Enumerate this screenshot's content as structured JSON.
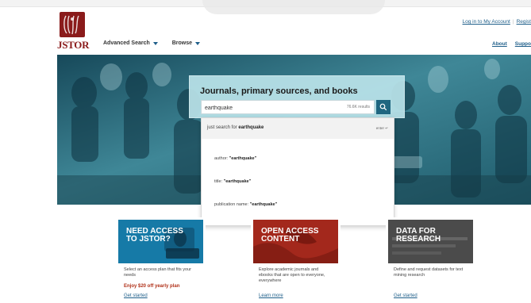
{
  "brand": {
    "logo_text": "JSTOR"
  },
  "header": {
    "login_link": "Log in to My Account",
    "register_link": "Regist",
    "about_link": "About",
    "support_link": "Suppo",
    "nav": [
      {
        "label": "Advanced Search"
      },
      {
        "label": "Browse"
      }
    ]
  },
  "hero": {
    "search": {
      "title": "Journals, primary sources, and books",
      "value": "earthquake",
      "result_count": "76.6K results"
    }
  },
  "dropdown": {
    "primary_prefix": "just search for",
    "primary_term": "earthquake",
    "enter_hint": "enter ↵",
    "suggestions": [
      {
        "field": "author:",
        "value": "\"earthquake\""
      },
      {
        "field": "title:",
        "value": "\"earthquake\""
      },
      {
        "field": "publication name:",
        "value": "\"earthquake\""
      }
    ]
  },
  "cards": [
    {
      "title_line1": "NEED ACCESS",
      "title_line2": "TO JSTOR?",
      "description": "Select an access plan that fits your needs",
      "promo": "Enjoy $20 off yearly plan",
      "link": "Get started"
    },
    {
      "title_line1": "OPEN ACCESS",
      "title_line2": "CONTENT",
      "description": "Explore academic journals and ebooks that are open to everyone, everywhere",
      "link": "Learn more"
    },
    {
      "title_line1": "DATA FOR",
      "title_line2": "RESEARCH",
      "description": "Define and request datasets for text mining research",
      "link": "Get started"
    }
  ],
  "colors": {
    "brand_red": "#8a1b1b",
    "link_blue": "#1f5f8a",
    "hero_teal": "#2d6d7d",
    "search_button": "#1f6680"
  }
}
